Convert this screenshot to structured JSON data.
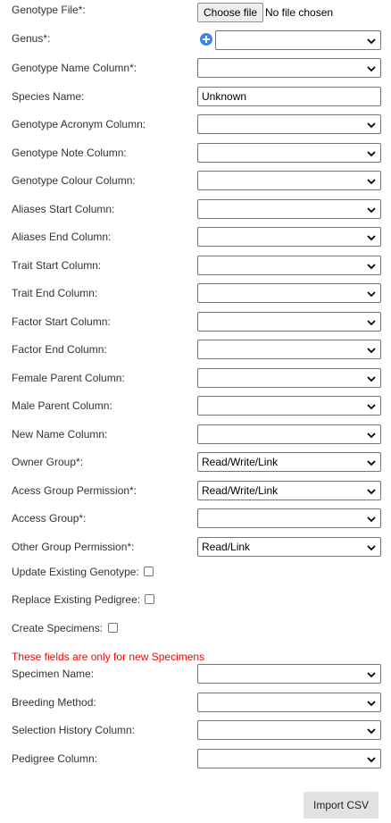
{
  "file": {
    "label": "Genotype File*:",
    "button_label": "Choose file",
    "status": "No file chosen"
  },
  "genus": {
    "label": "Genus*:",
    "value": ""
  },
  "fields": [
    {
      "label": "Genotype Name Column*:",
      "value": ""
    },
    {
      "label": "Species Name:",
      "value": "Unknown",
      "kind": "text"
    },
    {
      "label": "Genotype Acronym Column:",
      "value": ""
    },
    {
      "label": "Genotype Note Column:",
      "value": ""
    },
    {
      "label": "Genotype Colour Column:",
      "value": ""
    },
    {
      "label": "Aliases Start Column:",
      "value": ""
    },
    {
      "label": "Aliases End Column:",
      "value": ""
    },
    {
      "label": "Trait Start Column:",
      "value": ""
    },
    {
      "label": "Trait End Column:",
      "value": ""
    },
    {
      "label": "Factor Start Column:",
      "value": ""
    },
    {
      "label": "Factor End Column:",
      "value": ""
    },
    {
      "label": "Female Parent Column:",
      "value": ""
    },
    {
      "label": "Male Parent Column:",
      "value": ""
    },
    {
      "label": "New Name Column:",
      "value": ""
    },
    {
      "label": "Owner Group*:",
      "value": "Read/Write/Link"
    },
    {
      "label": "Acess Group Permission*:",
      "value": "Read/Write/Link"
    },
    {
      "label": "Access Group*:",
      "value": ""
    },
    {
      "label": "Other Group Permission*:",
      "value": "Read/Link"
    }
  ],
  "checkboxes": [
    {
      "label": "Update Existing Genotype:",
      "checked": false
    },
    {
      "label": "Replace Existing Pedigree:",
      "checked": false
    },
    {
      "label": "Create Specimens:",
      "checked": false
    }
  ],
  "specimen_notice": "These fields are only for new Specimens",
  "specimen_fields": [
    {
      "label": "Specimen Name:",
      "value": ""
    },
    {
      "label": "Breeding Method:",
      "value": ""
    },
    {
      "label": "Selection History Column:",
      "value": ""
    },
    {
      "label": "Pedigree Column:",
      "value": ""
    }
  ],
  "import_button": "Import CSV",
  "colors": {
    "notice": "#ff0000",
    "plus_icon": "#3b86e6"
  }
}
